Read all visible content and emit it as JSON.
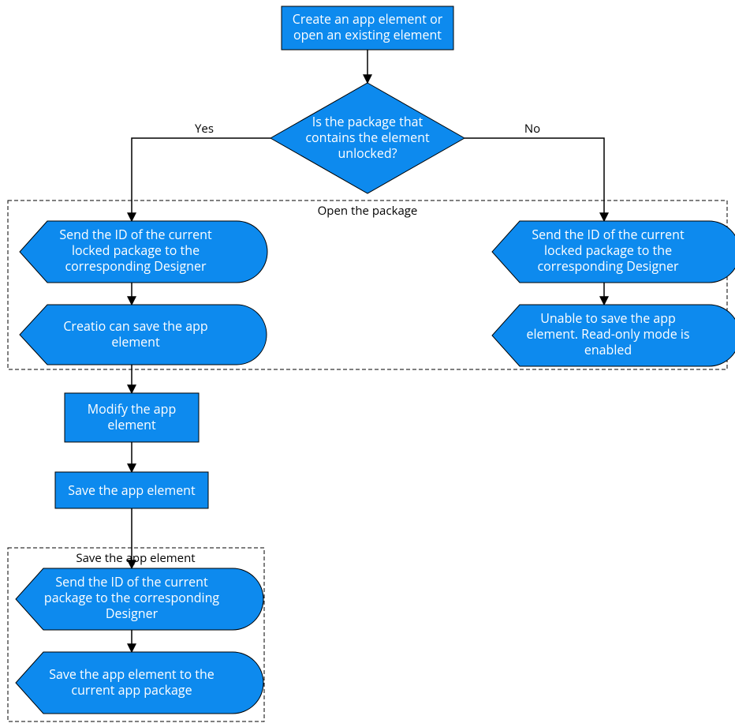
{
  "colors": {
    "nodeFill": "#0d8aee",
    "nodeStroke": "#000000",
    "edge": "#000000",
    "groupStroke": "#000000"
  },
  "groups": {
    "openPackage": {
      "title": "Open the package"
    },
    "saveElement": {
      "title": "Save the app element"
    }
  },
  "labels": {
    "yes": "Yes",
    "no": "No"
  },
  "nodes": {
    "start": {
      "line1": "Create an app element or",
      "line2": "open an existing element"
    },
    "decision": {
      "line1": "Is the package that",
      "line2": "contains the element",
      "line3": "unlocked?"
    },
    "yesSend": {
      "line1": "Send the ID of the current",
      "line2": "locked package to the",
      "line3": "corresponding Designer"
    },
    "canSave": {
      "line1": "Creatio can save the app",
      "line2": "element"
    },
    "noSend": {
      "line1": "Send the ID of the current",
      "line2": "locked package to the",
      "line3": "corresponding Designer"
    },
    "readOnly": {
      "line1": "Unable to save the app",
      "line2": "element. Read-only mode is",
      "line3": "enabled"
    },
    "modify": {
      "line1": "Modify the app",
      "line2": "element"
    },
    "save": {
      "line1": "Save the app element"
    },
    "sendCurrent": {
      "line1": "Send the ID of the current",
      "line2": "package to the corresponding",
      "line3": "Designer"
    },
    "saveToPkg": {
      "line1": "Save the app element to the",
      "line2": "current app package"
    }
  }
}
